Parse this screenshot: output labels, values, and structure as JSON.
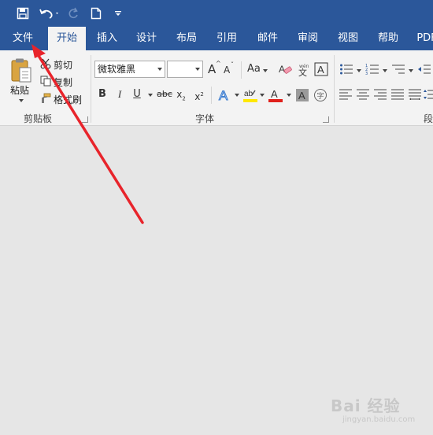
{
  "quick_access": {
    "save_icon": "save-icon",
    "undo_icon": "undo-icon",
    "redo_icon": "redo-icon",
    "new_doc_icon": "new-document-icon",
    "customize_icon": "customize-qat-icon"
  },
  "tabs": [
    {
      "label": "文件"
    },
    {
      "label": "开始"
    },
    {
      "label": "插入"
    },
    {
      "label": "设计"
    },
    {
      "label": "布局"
    },
    {
      "label": "引用"
    },
    {
      "label": "邮件"
    },
    {
      "label": "审阅"
    },
    {
      "label": "视图"
    },
    {
      "label": "帮助"
    },
    {
      "label": "PDF"
    }
  ],
  "active_tab": "开始",
  "clipboard": {
    "paste_label": "粘贴",
    "cut_label": "剪切",
    "copy_label": "复制",
    "format_painter_label": "格式刷",
    "group_label": "剪贴板"
  },
  "font": {
    "font_name": "微软雅黑",
    "font_size": "",
    "grow_label": "A",
    "shrink_label": "A",
    "case_label": "Aa",
    "clear_label": "A",
    "pinyin_label": "文",
    "border_label": "A",
    "bold": "B",
    "italic": "I",
    "underline": "U",
    "strike": "abc",
    "subscript": "x",
    "superscript": "x",
    "text_effect": "A",
    "highlight": "ab",
    "font_color": "A",
    "shading": "A",
    "enclose": "字",
    "group_label": "字体"
  },
  "paragraph": {
    "group_label": "段"
  },
  "colors": {
    "accent": "#2b579a",
    "ribbon_bg": "#f3f3f3",
    "highlight_yellow": "#ffe800",
    "font_red": "#e0201b",
    "arrow_red": "#e8242b"
  },
  "watermark": {
    "text": "Bai 经验",
    "sub": "jingyan.baidu.com"
  }
}
